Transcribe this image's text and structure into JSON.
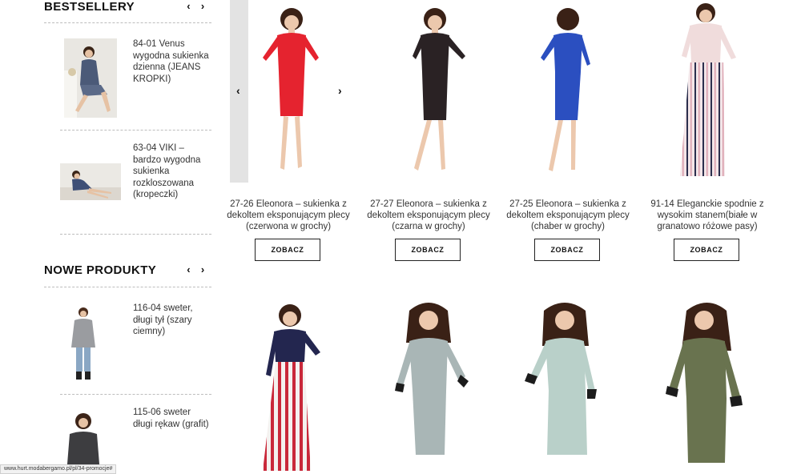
{
  "bestsellers": {
    "title": "BESTSELLERY",
    "items": [
      {
        "name": "84-01 Venus wygodna sukienka dzienna (JEANS KROPKI)"
      },
      {
        "name": "63-04 VIKI – bardzo wygodna sukienka rozkloszowana (kropeczki)"
      }
    ]
  },
  "new_products": {
    "title": "NOWE PRODUKTY",
    "items": [
      {
        "name": "116-04 sweter, długi tył (szary ciemny)"
      },
      {
        "name": "115-06 sweter długi rękaw (grafit)"
      }
    ]
  },
  "products": [
    {
      "name": "27-26 Eleonora – sukienka z dekoltem eksponującym plecy (czerwona w grochy)",
      "button": "ZOBACZ",
      "color": "#e5232f"
    },
    {
      "name": "27-27 Eleonora – sukienka z dekoltem eksponującym plecy (czarna w grochy)",
      "button": "ZOBACZ",
      "color": "#2a2224"
    },
    {
      "name": "27-25 Eleonora – sukienka z dekoltem eksponującym plecy (chaber w grochy)",
      "button": "ZOBACZ",
      "color": "#2b4fc0"
    },
    {
      "name": "91-14 Eleganckie spodnie z wysokim stanem(białe w granatowo różowe pasy)",
      "button": "ZOBACZ",
      "color": "#f0dcdc"
    }
  ],
  "products_row2": [
    {
      "color": "#c9283a",
      "top_color": "#23264f"
    },
    {
      "color": "#a9b6b6"
    },
    {
      "color": "#b9d0c9"
    },
    {
      "color": "#69734f"
    }
  ],
  "icons": {
    "prev": "chevron-left-icon",
    "next": "chevron-right-icon"
  },
  "symbols": {
    "prev": "‹",
    "next": "›"
  },
  "status_url": "www.hurt.modabergamo.pl/pl/34-promocje#"
}
